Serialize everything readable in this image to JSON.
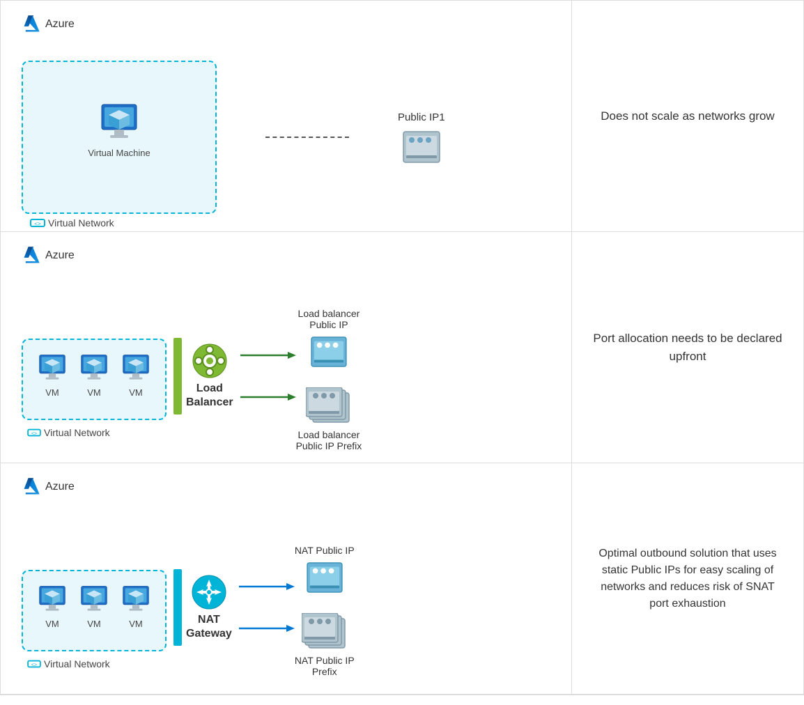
{
  "rows": [
    {
      "diagram": {
        "azure_label": "Azure",
        "vnet_label": "Virtual Network",
        "vm_label": "Virtual Machine",
        "public_ip_label": "Public IP1"
      },
      "description": "Does not scale as networks grow"
    },
    {
      "diagram": {
        "azure_label": "Azure",
        "vnet_label": "Virtual Network",
        "vms": [
          "VM",
          "VM",
          "VM"
        ],
        "connector_label": "Load\nBalancer",
        "top_label": "Load balancer\nPublic IP",
        "bottom_label": "Load balancer\nPublic IP Prefix"
      },
      "description": "Port allocation needs to be declared upfront"
    },
    {
      "diagram": {
        "azure_label": "Azure",
        "vnet_label": "Virtual Network",
        "vms": [
          "VM",
          "VM",
          "VM"
        ],
        "connector_label": "NAT\nGateway",
        "top_label": "NAT Public IP",
        "bottom_label": "NAT Public IP\nPrefix"
      },
      "description": "Optimal outbound solution that uses static Public IPs for easy scaling of networks and reduces risk of SNAT port exhaustion"
    }
  ]
}
